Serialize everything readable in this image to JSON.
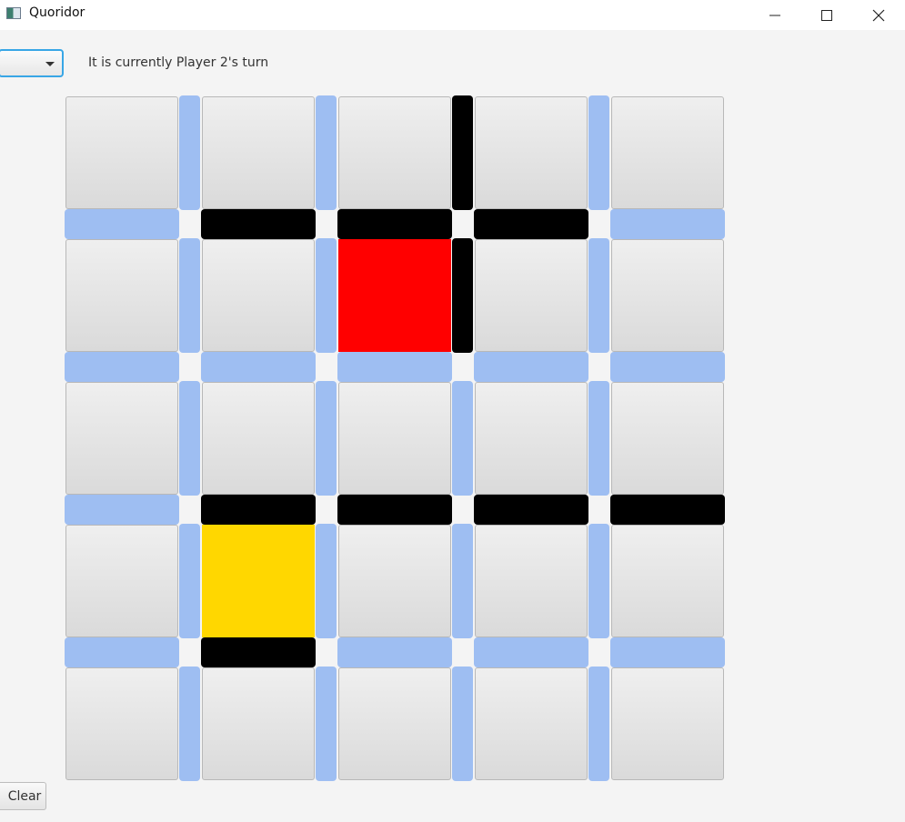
{
  "window": {
    "title": "Quoridor",
    "icon": "app-window-icon",
    "controls": [
      "minimize-icon",
      "maximize-icon",
      "close-icon"
    ]
  },
  "toolbar": {
    "dropdown_value": "",
    "turn_text": "It is currently Player 2's turn"
  },
  "board": {
    "size": 5,
    "player_colors": {
      "player1": "#ff0000",
      "player2": "#ffd700"
    },
    "wall_colors": {
      "empty": "#9ebef2",
      "placed": "#000000"
    },
    "pawns": [
      {
        "player": "player1",
        "row": 1,
        "col": 2
      },
      {
        "player": "player2",
        "row": 3,
        "col": 1
      }
    ],
    "vertical_walls_placed": [
      [
        false,
        false,
        true,
        false
      ],
      [
        false,
        false,
        true,
        false
      ],
      [
        false,
        false,
        false,
        false
      ],
      [
        false,
        false,
        false,
        false
      ],
      [
        false,
        false,
        false,
        false
      ]
    ],
    "horizontal_walls_placed": [
      [
        false,
        true,
        true,
        true,
        false
      ],
      [
        false,
        false,
        false,
        false,
        false
      ],
      [
        false,
        true,
        true,
        true,
        true
      ],
      [
        false,
        true,
        false,
        false,
        false
      ]
    ]
  },
  "footer": {
    "clear_label": "Clear"
  }
}
